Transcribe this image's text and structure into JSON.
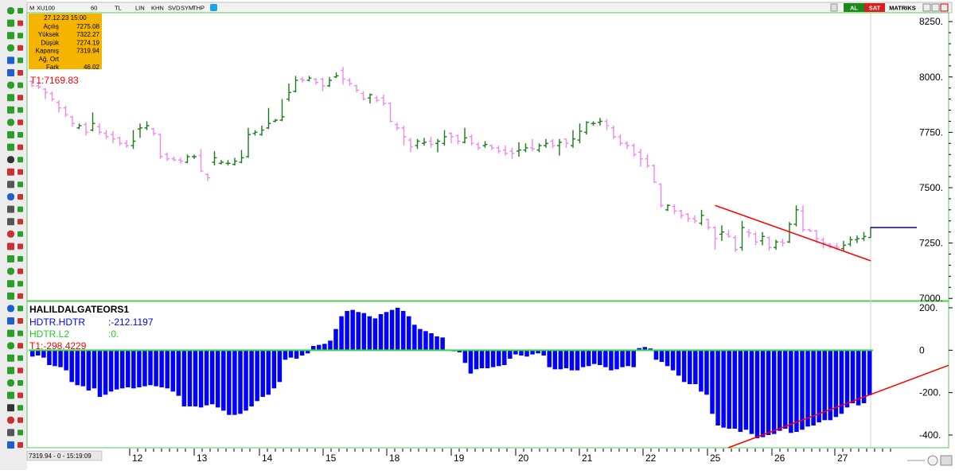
{
  "topbar": {
    "items": [
      "M",
      "XU100",
      "60",
      "TL",
      "LIN",
      "KHN",
      "SVD",
      "SYM",
      "THP"
    ],
    "right_tabs": [
      "AL",
      "SAT",
      "MATRIKS"
    ]
  },
  "info_box": {
    "datetime": "27.12.23 15:00",
    "rows": [
      {
        "label": "Açılış",
        "value": "7275.08"
      },
      {
        "label": "Yüksek",
        "value": "7322.27"
      },
      {
        "label": "Düşük",
        "value": "7274.19"
      },
      {
        "label": "Kapanış",
        "value": "7319.94"
      },
      {
        "label": "Ağ. Ort",
        "value": ""
      },
      {
        "label": "Fark",
        "value": "46.02"
      }
    ]
  },
  "price_panel": {
    "t1_label": "T1:7169.83"
  },
  "indicator_panel": {
    "title": "HALILDALGATEORS1",
    "lines": [
      {
        "text": "HDTR.HDTR",
        "value": ":-212.1197"
      },
      {
        "text": "HDTR.L2",
        "value": ":0."
      },
      {
        "text": "T1:-298.4229",
        "value": ""
      }
    ]
  },
  "status_text": "7319.94 - 0 - 15:19:09",
  "colors": {
    "up_bar": "#1a7a1a",
    "down_bar": "#ee88ee",
    "trend_line": "#ff0000",
    "histogram": "#0000ff",
    "zero_line": "#33dd33",
    "price_line": "#0000cc",
    "panel_border": "#55cc55"
  },
  "chart_data": [
    {
      "type": "ohlc",
      "yticks": [
        "8250.",
        "8000.",
        "7750.",
        "7500.",
        "7250.",
        "7000."
      ],
      "ylim": [
        6990,
        8290
      ],
      "xticks": [
        "12",
        "13",
        "14",
        "15",
        "18",
        "19",
        "20",
        "21",
        "22",
        "25",
        "26",
        "27"
      ],
      "last_price": 7319.94,
      "trend_line": [
        [
          7420,
          7170
        ]
      ],
      "bars": [
        [
          7980,
          7960,
          7985,
          7955
        ],
        [
          7960,
          7955,
          7970,
          7945
        ],
        [
          7945,
          7930,
          7950,
          7900
        ],
        [
          7925,
          7900,
          7935,
          7890
        ],
        [
          7885,
          7860,
          7895,
          7840
        ],
        [
          7860,
          7830,
          7870,
          7820
        ],
        [
          7820,
          7790,
          7825,
          7775
        ],
        [
          7770,
          7780,
          7790,
          7765
        ],
        [
          7785,
          7750,
          7795,
          7735
        ],
        [
          7760,
          7790,
          7840,
          7755
        ],
        [
          7775,
          7750,
          7790,
          7740
        ],
        [
          7745,
          7730,
          7760,
          7720
        ],
        [
          7740,
          7720,
          7755,
          7700
        ],
        [
          7725,
          7700,
          7730,
          7690
        ],
        [
          7700,
          7690,
          7715,
          7680
        ],
        [
          7690,
          7710,
          7760,
          7675
        ],
        [
          7765,
          7770,
          7790,
          7725
        ],
        [
          7770,
          7780,
          7800,
          7760
        ],
        [
          7765,
          7745,
          7770,
          7735
        ],
        [
          7740,
          7640,
          7745,
          7630
        ],
        [
          7650,
          7630,
          7660,
          7620
        ],
        [
          7630,
          7625,
          7640,
          7620
        ],
        [
          7625,
          7620,
          7635,
          7610
        ],
        [
          7615,
          7640,
          7650,
          7610
        ],
        [
          7640,
          7640,
          7650,
          7630
        ],
        [
          7645,
          7575,
          7675,
          7570
        ],
        [
          7560,
          7545,
          7565,
          7530
        ],
        [
          7615,
          7635,
          7665,
          7600
        ],
        [
          7610,
          7615,
          7625,
          7605
        ],
        [
          7610,
          7610,
          7625,
          7600
        ],
        [
          7605,
          7620,
          7635,
          7600
        ],
        [
          7615,
          7635,
          7670,
          7610
        ],
        [
          7640,
          7740,
          7770,
          7635
        ],
        [
          7745,
          7750,
          7760,
          7735
        ],
        [
          7740,
          7760,
          7780,
          7735
        ],
        [
          7770,
          7790,
          7860,
          7765
        ],
        [
          7800,
          7805,
          7810,
          7795
        ],
        [
          7805,
          7820,
          7900,
          7800
        ],
        [
          7900,
          7930,
          7970,
          7890
        ],
        [
          7935,
          7985,
          8005,
          7930
        ],
        [
          7990,
          7985,
          8000,
          7975
        ],
        [
          7985,
          7995,
          8005,
          7980
        ],
        [
          7990,
          7975,
          7995,
          7965
        ],
        [
          7990,
          7960,
          7995,
          7935
        ],
        [
          7960,
          7985,
          8000,
          7955
        ],
        [
          8000,
          8005,
          8020,
          7995
        ],
        [
          8030,
          7990,
          8045,
          7965
        ],
        [
          7985,
          7970,
          7995,
          7960
        ],
        [
          7960,
          7940,
          7965,
          7930
        ],
        [
          7925,
          7900,
          7935,
          7895
        ],
        [
          7905,
          7920,
          7925,
          7880
        ],
        [
          7905,
          7895,
          7915,
          7885
        ],
        [
          7905,
          7880,
          7920,
          7870
        ],
        [
          7880,
          7800,
          7885,
          7795
        ],
        [
          7785,
          7770,
          7795,
          7760
        ],
        [
          7770,
          7730,
          7780,
          7690
        ],
        [
          7715,
          7685,
          7725,
          7660
        ],
        [
          7690,
          7710,
          7720,
          7675
        ],
        [
          7700,
          7705,
          7725,
          7690
        ],
        [
          7710,
          7695,
          7730,
          7680
        ],
        [
          7700,
          7710,
          7720,
          7660
        ],
        [
          7700,
          7730,
          7760,
          7690
        ],
        [
          7745,
          7730,
          7750,
          7700
        ],
        [
          7735,
          7710,
          7740,
          7695
        ],
        [
          7705,
          7725,
          7770,
          7700
        ],
        [
          7730,
          7700,
          7740,
          7690
        ],
        [
          7695,
          7680,
          7705,
          7670
        ],
        [
          7690,
          7695,
          7710,
          7680
        ],
        [
          7690,
          7680,
          7695,
          7670
        ],
        [
          7680,
          7665,
          7690,
          7655
        ],
        [
          7670,
          7655,
          7690,
          7645
        ],
        [
          7665,
          7655,
          7680,
          7630
        ],
        [
          7665,
          7670,
          7705,
          7640
        ],
        [
          7670,
          7680,
          7700,
          7660
        ],
        [
          7680,
          7675,
          7720,
          7665
        ],
        [
          7670,
          7690,
          7700,
          7660
        ],
        [
          7690,
          7700,
          7720,
          7680
        ],
        [
          7710,
          7690,
          7720,
          7680
        ],
        [
          7690,
          7705,
          7720,
          7645
        ],
        [
          7720,
          7700,
          7720,
          7680
        ],
        [
          7690,
          7720,
          7760,
          7680
        ],
        [
          7715,
          7755,
          7790,
          7700
        ],
        [
          7750,
          7795,
          7800,
          7740
        ],
        [
          7790,
          7790,
          7800,
          7780
        ],
        [
          7795,
          7800,
          7815,
          7780
        ],
        [
          7800,
          7780,
          7810,
          7760
        ],
        [
          7770,
          7730,
          7780,
          7720
        ],
        [
          7730,
          7700,
          7740,
          7690
        ],
        [
          7700,
          7690,
          7710,
          7675
        ],
        [
          7690,
          7650,
          7700,
          7640
        ],
        [
          7660,
          7630,
          7675,
          7595
        ],
        [
          7630,
          7600,
          7650,
          7590
        ],
        [
          7600,
          7525,
          7605,
          7520
        ],
        [
          7515,
          7420,
          7520,
          7410
        ],
        [
          7400,
          7420,
          7425,
          7395
        ],
        [
          7415,
          7395,
          7425,
          7380
        ],
        [
          7395,
          7375,
          7400,
          7360
        ],
        [
          7380,
          7360,
          7385,
          7345
        ],
        [
          7360,
          7350,
          7375,
          7340
        ],
        [
          7340,
          7375,
          7400,
          7330
        ],
        [
          7355,
          7320,
          7360,
          7310
        ],
        [
          7320,
          7270,
          7325,
          7220
        ],
        [
          7290,
          7300,
          7330,
          7260
        ],
        [
          7290,
          7280,
          7310,
          7275
        ],
        [
          7275,
          7220,
          7285,
          7210
        ],
        [
          7230,
          7320,
          7350,
          7215
        ],
        [
          7300,
          7295,
          7315,
          7275
        ],
        [
          7290,
          7255,
          7300,
          7240
        ],
        [
          7260,
          7280,
          7300,
          7240
        ],
        [
          7275,
          7230,
          7280,
          7215
        ],
        [
          7230,
          7255,
          7265,
          7220
        ],
        [
          7255,
          7250,
          7270,
          7235
        ],
        [
          7255,
          7335,
          7345,
          7250
        ],
        [
          7335,
          7400,
          7420,
          7325
        ],
        [
          7395,
          7310,
          7420,
          7300
        ],
        [
          7310,
          7305,
          7315,
          7300
        ],
        [
          7305,
          7270,
          7310,
          7250
        ],
        [
          7265,
          7250,
          7275,
          7225
        ],
        [
          7245,
          7235,
          7250,
          7225
        ],
        [
          7235,
          7230,
          7250,
          7220
        ],
        [
          7225,
          7240,
          7260,
          7215
        ],
        [
          7245,
          7265,
          7280,
          7235
        ],
        [
          7265,
          7270,
          7285,
          7250
        ],
        [
          7270,
          7280,
          7300,
          7260
        ],
        [
          7275,
          7320,
          7322,
          7274
        ]
      ]
    },
    {
      "type": "bar",
      "title": "HALILDALGATEORS1",
      "series": [
        {
          "name": "HDTR.HDTR"
        }
      ],
      "yticks": [
        "200.",
        "0",
        "-200.",
        "-400."
      ],
      "ylim": [
        -460,
        230
      ],
      "zero_line": 0,
      "trend_line": [
        [
          -460,
          -298
        ]
      ],
      "values": [
        -30,
        -25,
        -35,
        -70,
        -75,
        -80,
        -95,
        -150,
        -165,
        -170,
        -190,
        -180,
        -220,
        -210,
        -195,
        -185,
        -180,
        -175,
        -180,
        -175,
        -170,
        -165,
        -170,
        -175,
        -180,
        -195,
        -215,
        -265,
        -265,
        -265,
        -270,
        -260,
        -255,
        -270,
        -285,
        -305,
        -305,
        -300,
        -285,
        -265,
        -240,
        -220,
        -210,
        -180,
        -150,
        -45,
        -35,
        -40,
        -25,
        -15,
        20,
        25,
        30,
        45,
        100,
        160,
        185,
        190,
        180,
        175,
        160,
        150,
        170,
        180,
        190,
        200,
        185,
        160,
        120,
        100,
        90,
        80,
        65,
        60,
        0,
        -5,
        -10,
        -60,
        -110,
        -90,
        -85,
        -85,
        -80,
        -75,
        -70,
        -40,
        -20,
        -25,
        -30,
        -20,
        -15,
        -25,
        -80,
        -90,
        -90,
        -85,
        -95,
        -95,
        -80,
        -75,
        -65,
        -70,
        -80,
        -95,
        -90,
        -80,
        -75,
        -80,
        10,
        15,
        8,
        -45,
        -55,
        -75,
        -95,
        -120,
        -150,
        -160,
        -160,
        -195,
        -210,
        -300,
        -355,
        -365,
        -370,
        -370,
        -385,
        -375,
        -395,
        -415,
        -410,
        -400,
        -395,
        -380,
        -370,
        -390,
        -385,
        -375,
        -360,
        -355,
        -340,
        -330,
        -330,
        -315,
        -300,
        -270,
        -250,
        -260,
        -250,
        -212
      ]
    }
  ]
}
